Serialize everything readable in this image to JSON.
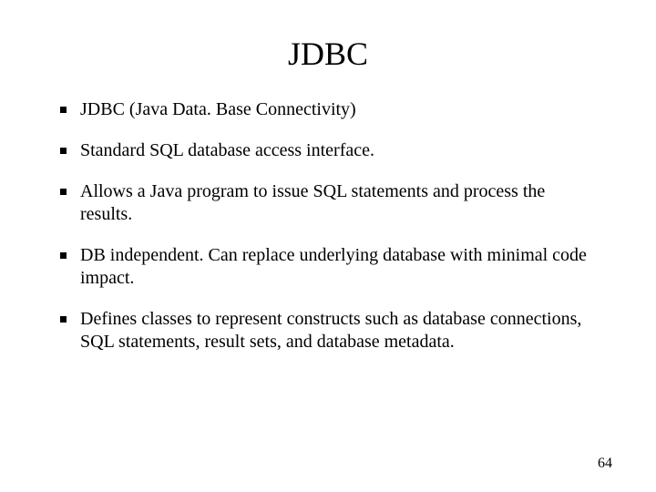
{
  "title": "JDBC",
  "bullets": [
    "JDBC (Java Data. Base Connectivity)",
    "Standard SQL database access interface.",
    "Allows a Java program to issue SQL statements and process the results.",
    "DB independent. Can replace underlying database with minimal code impact.",
    "Defines classes to represent constructs such as database connections, SQL statements, result sets, and database metadata."
  ],
  "page_number": "64"
}
